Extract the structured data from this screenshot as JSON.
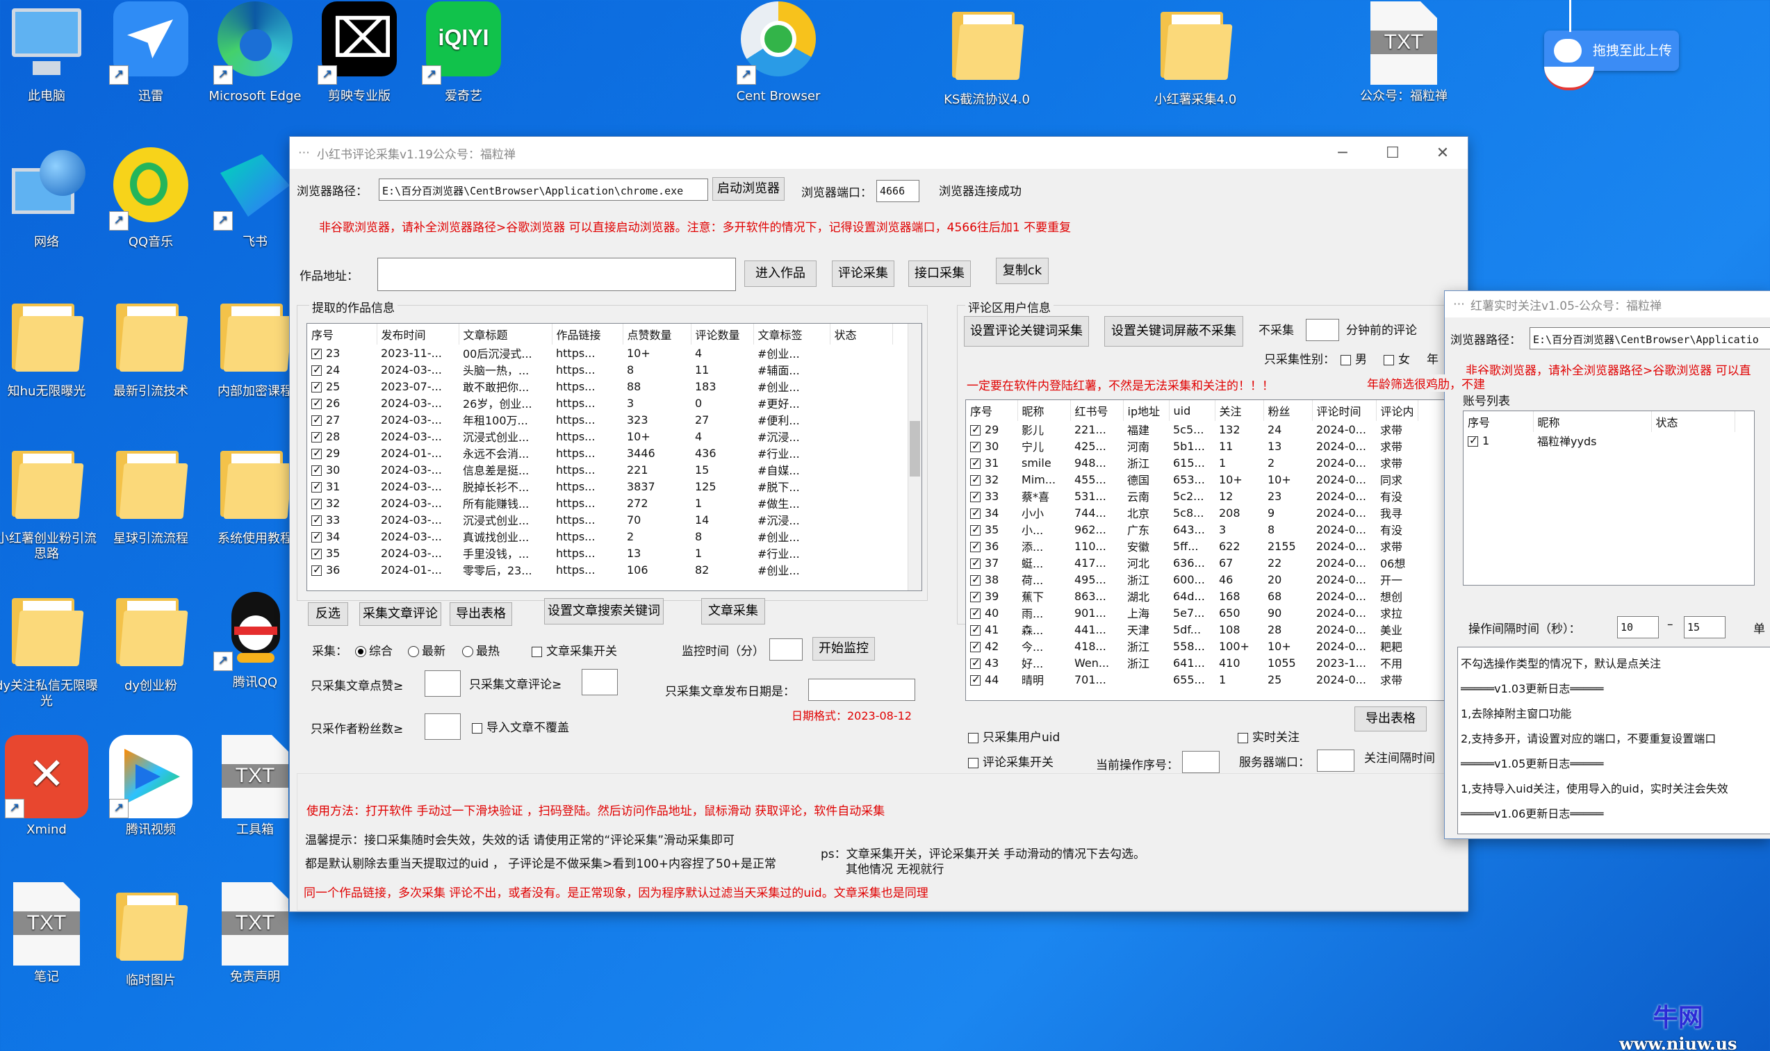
{
  "desktop": {
    "icons": [
      {
        "label": "此电脑",
        "type": "pc"
      },
      {
        "label": "迅雷",
        "type": "xunlei"
      },
      {
        "label": "Microsoft Edge",
        "type": "edge"
      },
      {
        "label": "剪映专业版",
        "type": "capcut"
      },
      {
        "label": "爱奇艺",
        "type": "iqiyi",
        "text": "iQIYI"
      },
      {
        "label": "Cent Browser",
        "type": "cent"
      },
      {
        "label": "KS截流协议4.0",
        "type": "folder"
      },
      {
        "label": "小红薯采集4.0",
        "type": "folder"
      },
      {
        "label": "公众号：福粒禅",
        "type": "txt"
      },
      {
        "label": "网络",
        "type": "net"
      },
      {
        "label": "QQ音乐",
        "type": "qqmusic"
      },
      {
        "label": "飞书",
        "type": "feishu"
      },
      {
        "label": "知hu无限曝光",
        "type": "folder"
      },
      {
        "label": "最新引流技术",
        "type": "folder"
      },
      {
        "label": "内部加密课程",
        "type": "folder"
      },
      {
        "label": "小红薯创业粉引流思路",
        "type": "folder"
      },
      {
        "label": "星球引流流程",
        "type": "folder"
      },
      {
        "label": "系统使用教程",
        "type": "folder"
      },
      {
        "label": "dy关注私信无限曝光",
        "type": "folder"
      },
      {
        "label": "dy创业粉",
        "type": "folder"
      },
      {
        "label": "腾讯QQ",
        "type": "qq"
      },
      {
        "label": "Xmind",
        "type": "xmind"
      },
      {
        "label": "腾讯视频",
        "type": "tvideo"
      },
      {
        "label": "工具箱",
        "type": "txt"
      },
      {
        "label": "笔记",
        "type": "txt"
      },
      {
        "label": "临时图片",
        "type": "folder"
      },
      {
        "label": "免责声明",
        "type": "txt"
      }
    ],
    "txt_badge": "TXT",
    "upload_pill": "拖拽至此上传",
    "watermark": {
      "line1": "牛网",
      "line2": "www.niuw.us"
    }
  },
  "main_window": {
    "title": "小红书评论采集v1.19公众号：福粒禅",
    "browser_path_label": "浏览器路径：",
    "browser_path_value": "E:\\百分百浏览器\\CentBrowser\\Application\\chrome.exe",
    "start_browser_btn": "启动浏览器",
    "port_label": "浏览器端口：",
    "port_value": "4666",
    "conn_status": "浏览器连接成功",
    "warning": "非谷歌浏览器，请补全浏览器路径>谷歌浏览器 可以直接启动浏览器。注意：多开软件的情况下，记得设置浏览器端口，4566往后加1  不要重复",
    "work_addr_label": "作品地址：",
    "btn_enter": "进入作品",
    "btn_comment": "评论采集",
    "btn_api": "接口采集",
    "btn_copy_ck": "复制ck",
    "works_group": "提取的作品信息",
    "works_cols": [
      "序号",
      "发布时间",
      "文章标题",
      "作品链接",
      "点赞数量",
      "评论数量",
      "文章标签",
      "状态"
    ],
    "works_rows": [
      [
        "23",
        "2023-11-...",
        "00后沉浸式...",
        "https...",
        "10+",
        "4",
        "#创业..."
      ],
      [
        "24",
        "2024-03-...",
        "头脑一热，...",
        "https...",
        "8",
        "11",
        "#辅面..."
      ],
      [
        "25",
        "2023-07-...",
        "敢不敢把你...",
        "https...",
        "88",
        "183",
        "#创业..."
      ],
      [
        "26",
        "2024-03-...",
        "26岁，创业...",
        "https...",
        "3",
        "0",
        "#更好..."
      ],
      [
        "27",
        "2024-03-...",
        "年租100万...",
        "https...",
        "323",
        "27",
        "#便利..."
      ],
      [
        "28",
        "2024-03-...",
        "沉浸式创业...",
        "https...",
        "10+",
        "4",
        "#沉浸..."
      ],
      [
        "29",
        "2024-01-...",
        "永远不会消...",
        "https...",
        "3446",
        "436",
        "#行业..."
      ],
      [
        "30",
        "2024-03-...",
        "信息差是挺...",
        "https...",
        "221",
        "15",
        "#自媒..."
      ],
      [
        "31",
        "2024-03-...",
        "脱掉长衫不...",
        "https...",
        "3837",
        "125",
        "#脱下..."
      ],
      [
        "32",
        "2024-03-...",
        "所有能赚钱...",
        "https...",
        "272",
        "1",
        "#做生..."
      ],
      [
        "33",
        "2024-03-...",
        "沉浸式创业...",
        "https...",
        "70",
        "14",
        "#沉浸..."
      ],
      [
        "34",
        "2024-03-...",
        "真诚找创业...",
        "https...",
        "2",
        "8",
        "#创业..."
      ],
      [
        "35",
        "2024-03-...",
        "手里没钱，...",
        "https...",
        "13",
        "1",
        "#行业..."
      ],
      [
        "36",
        "2024-01-...",
        "零零后，23...",
        "https...",
        "106",
        "82",
        "#创业..."
      ]
    ],
    "btn_invert": "反选",
    "btn_collect_comments": "采集文章评论",
    "btn_export": "导出表格",
    "btn_set_keywords": "设置文章搜索关键词",
    "btn_article_collect": "文章采集",
    "collect_label": "采集：",
    "radio_all": "综合",
    "radio_new": "最新",
    "radio_hot": "最热",
    "chk_article_switch": "文章采集开关",
    "monitor_label": "监控时间（分）",
    "btn_start_monitor": "开始监控",
    "only_likes": "只采集文章点赞≥",
    "only_comments": "只采集文章评论≥",
    "only_date": "只采集文章发布日期是：",
    "date_format": "日期格式：2023-08-12",
    "only_fans": "只采作者粉丝数≥",
    "chk_no_overwrite": "导入文章不覆盖",
    "comment_group": "评论区用户信息",
    "btn_set_comment_kw": "设置评论关键词采集",
    "btn_set_block_kw": "设置关键词屏蔽不采集",
    "no_collect": "不采集",
    "minutes_before": "分钟前的评论",
    "gender_label": "只采集性别：",
    "male": "男",
    "female": "女",
    "age_label": "年",
    "login_warning": "一定要在软件内登陆红薯，不然是无法采集和关注的！！！",
    "comment_cols": [
      "序号",
      "昵称",
      "红书号",
      "ip地址",
      "uid",
      "关注",
      "粉丝",
      "评论时间",
      "评论内"
    ],
    "comment_rows": [
      [
        "29",
        "影儿",
        "221...",
        "福建",
        "5c5...",
        "132",
        "24",
        "2024-0...",
        "求带"
      ],
      [
        "30",
        "宁儿",
        "425...",
        "河南",
        "5b1...",
        "11",
        "13",
        "2024-0...",
        "求带"
      ],
      [
        "31",
        "smile",
        "948...",
        "浙江",
        "615...",
        "1",
        "2",
        "2024-0...",
        "求带"
      ],
      [
        "32",
        "Mim...",
        "455...",
        "德国",
        "653...",
        "10+",
        "10+",
        "2024-0...",
        "同求"
      ],
      [
        "33",
        "蔡*喜",
        "531...",
        "云南",
        "5c2...",
        "12",
        "23",
        "2024-0...",
        "有没"
      ],
      [
        "34",
        "小小",
        "744...",
        "北京",
        "5c8...",
        "208",
        "9",
        "2024-0...",
        "我寻"
      ],
      [
        "35",
        "小...",
        "962...",
        "广东",
        "643...",
        "3",
        "8",
        "2024-0...",
        "有没"
      ],
      [
        "36",
        "添...",
        "110...",
        "安徽",
        "5ff...",
        "622",
        "2155",
        "2024-0...",
        "求带"
      ],
      [
        "37",
        "蜓...",
        "417...",
        "河北",
        "636...",
        "67",
        "22",
        "2024-0...",
        "06想"
      ],
      [
        "38",
        "荷...",
        "495...",
        "浙江",
        "600...",
        "46",
        "20",
        "2024-0...",
        "开一"
      ],
      [
        "39",
        "蕉下",
        "863...",
        "湖北",
        "64d...",
        "168",
        "68",
        "2024-0...",
        "想创"
      ],
      [
        "40",
        "雨...",
        "901...",
        "上海",
        "5e7...",
        "650",
        "90",
        "2024-0...",
        "求拉"
      ],
      [
        "41",
        "森...",
        "441...",
        "天津",
        "5df...",
        "108",
        "28",
        "2024-0...",
        "美业"
      ],
      [
        "42",
        "今...",
        "418...",
        "浙江",
        "558...",
        "100+",
        "10+",
        "2024-0...",
        "耙耙"
      ],
      [
        "43",
        "好...",
        "Wen...",
        "浙江",
        "641...",
        "410",
        "1055",
        "2023-1...",
        "不用"
      ],
      [
        "44",
        "晴明",
        "701...",
        "",
        "655...",
        "1",
        "25",
        "2024-0...",
        "求带"
      ]
    ],
    "btn_export2": "导出表格",
    "chk_only_uid": "只采集用户uid",
    "chk_realtime_follow": "实时关注",
    "chk_comment_switch": "评论采集开关",
    "cur_op_label": "当前操作序号：",
    "server_port_label": "服务器端口：",
    "follow_interval_label": "关注间隔时间",
    "usage": "使用方法：打开软件  手动过一下滑块验证    ，扫码登陆。然后访问作品地址，鼠标滑动  获取评论，软件自动采集",
    "tip1": "温馨提示：接口采集随时会失效，失效的话 请使用正常的“评论采集”滑动采集即可",
    "tip2": "都是默认剔除去重当天提取过的uid ， 子评论是不做采集>看到100+内容捏了50+是正常",
    "ps": "ps：文章采集开关，评论采集开关  手动滑动的情况下去勾选。",
    "ps2": "其他情况  无视就行",
    "tip3": "同一个作品链接，多次采集    评论不出，或者没有。是正常现象，因为程序默认过滤当天采集过的uid。文章采集也是同理"
  },
  "follow_window": {
    "title": "红薯实时关注v1.05-公众号：福粒禅",
    "path_label": "浏览器路径：",
    "path_value": "E:\\百分百浏览器\\CentBrowser\\Applicatio",
    "warning": "非谷歌浏览器，请补全浏览器路径>谷歌浏览器 可以直",
    "age_warning": "年龄筛选很鸡肋，不建",
    "accounts_label": "账号列表",
    "acc_cols": [
      "序号",
      "昵称",
      "状态"
    ],
    "acc_rows": [
      [
        "1",
        "福粒禅yyds",
        ""
      ]
    ],
    "interval_label": "操作间隔时间（秒）：",
    "interval_from": "10",
    "interval_to": "15",
    "dash": "–",
    "single_label": "单",
    "log_lines": [
      "不勾选操作类型的情况下，默认是点关注",
      "═════v1.03更新日志═════",
      "1,去除掉附主窗口功能",
      "2,支持多开，请设置对应的端口，不要重复设置端口",
      "═════v1.05更新日志═════",
      "1,支持导入uid关注，使用导入的uid，实时关注会失效",
      "═════v1.06更新日志═════"
    ]
  }
}
